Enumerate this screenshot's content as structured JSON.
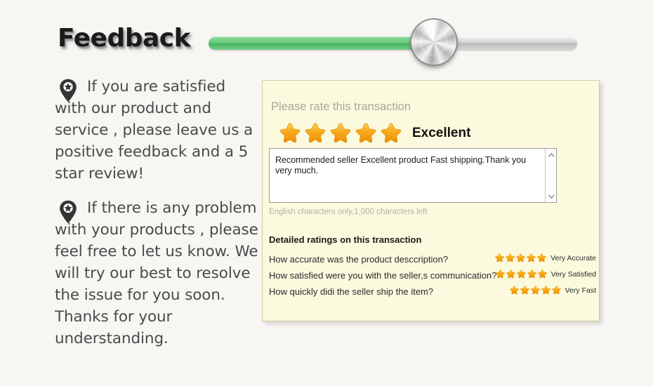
{
  "header": {
    "title": "Feedback",
    "slider": {
      "fill_percent": 61,
      "icon": "slider-knob-icon"
    }
  },
  "left_column": {
    "bullets": [
      {
        "icon": "map-pin-star-icon",
        "text": "If you are satisfied with our product and service , please leave us a positive feedback and a 5 star review!"
      },
      {
        "icon": "map-pin-star-icon",
        "text": "If there is any problem with your products , please feel free to let us know. We will try our best to resolve the issue for you soon. Thanks for your understanding."
      }
    ]
  },
  "panel": {
    "rate_prompt": "Please rate this transaction",
    "overall_rating": 5,
    "overall_label": "Excellent",
    "review": {
      "value": "Recommended seller Excellent product Fast shipping.Thank you very much.",
      "scrollbar": {
        "up_icon": "chevron-up-icon",
        "down_icon": "chevron-down-icon"
      }
    },
    "chars_left": "English characters only,1,000 characters left",
    "detailed_title": "Detailed ratings on this transaction",
    "detailed_ratings": [
      {
        "question": "How accurate was the product desccription?",
        "stars": 5,
        "label": "Very Accurate"
      },
      {
        "question": "How satisfied were you with the seller,s communication?",
        "stars": 5,
        "label": "Very Satisfied"
      },
      {
        "question": "How quickly didi the seller ship the item?",
        "stars": 5,
        "label": "Very Fast"
      }
    ]
  },
  "colors": {
    "page_background": "#f7f6f3",
    "panel_background": "#fbfade",
    "panel_border": "#cfc8a0",
    "star": "#f5a623",
    "slider_fill": "#5ec276",
    "muted_text": "#a8a89a"
  }
}
